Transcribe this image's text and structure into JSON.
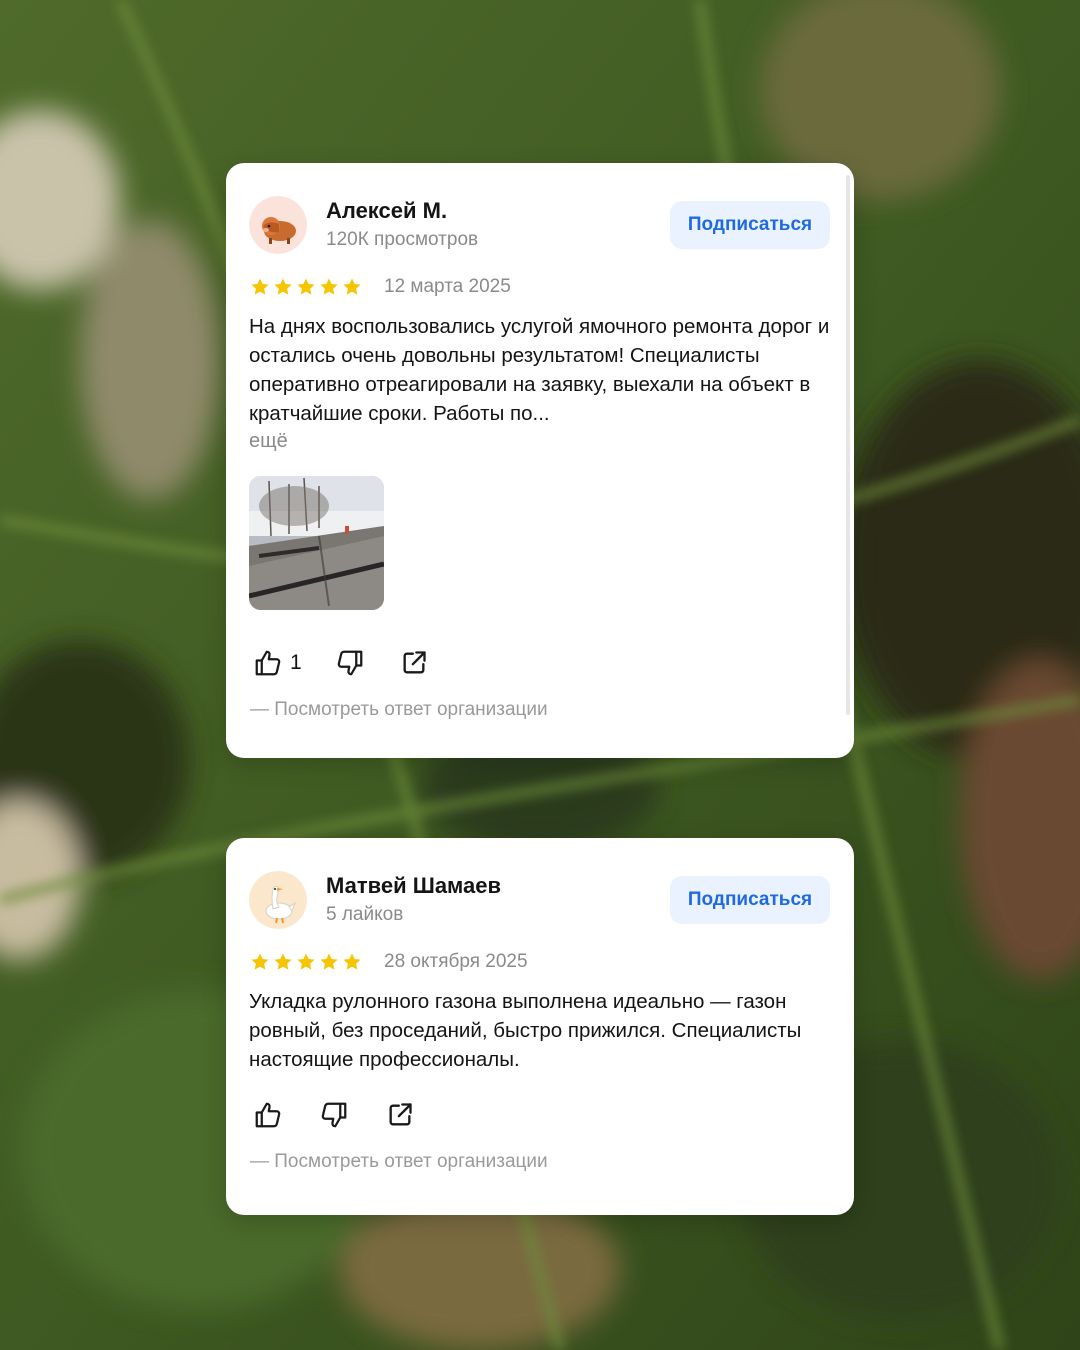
{
  "reviews": [
    {
      "author": "Алексей М.",
      "meta": "120К просмотров",
      "subscribe_label": "Подписаться",
      "rating": 5,
      "date": "12 марта 2025",
      "text": "На днях воспользовались услугой ямочного ремонта дорог и остались очень довольны результатом! Специалисты оперативно отреагировали на заявку, выехали на объект в кратчайшие сроки. Работы по...",
      "more_label": "ещё",
      "likes": "1",
      "org_reply_label": "— Посмотреть ответ организации",
      "avatar_icon": "yak-icon"
    },
    {
      "author": "Матвей Шамаев",
      "meta": "5 лайков",
      "subscribe_label": "Подписаться",
      "rating": 5,
      "date": "28 октября 2025",
      "text": "Укладка рулонного газона выполнена идеально — газон ровный, без проседаний, быстро прижился. Специалисты настоящие профессионалы.",
      "org_reply_label": "— Посмотреть ответ организации",
      "avatar_icon": "goose-icon"
    }
  ],
  "colors": {
    "star": "#f6c400",
    "subscribe_bg": "#eaf2ff",
    "subscribe_text": "#1f6ae0",
    "muted_text": "#8a8a8a"
  }
}
